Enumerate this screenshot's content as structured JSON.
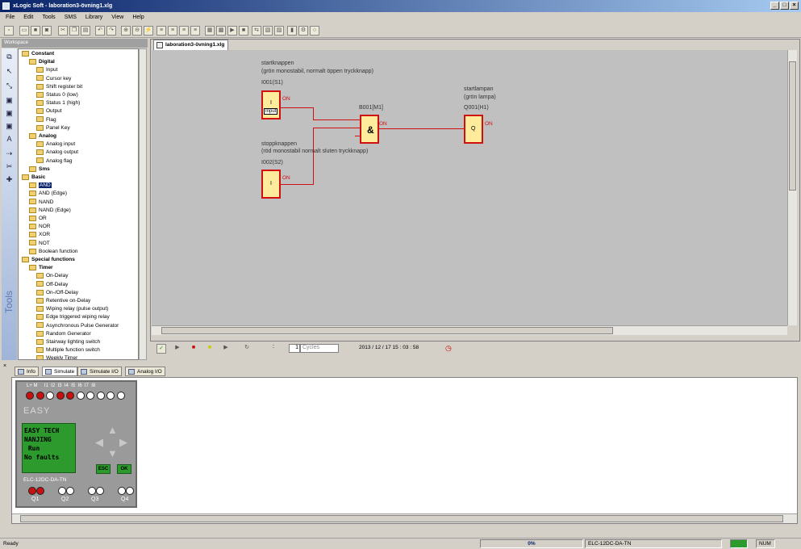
{
  "window": {
    "title": "xLogic Soft - laboration3-övning1.xlg"
  },
  "menu": [
    "File",
    "Edit",
    "Tools",
    "SMS",
    "Library",
    "View",
    "Help"
  ],
  "workspace": {
    "label": "Workspace",
    "vertical_label": "Tools"
  },
  "tree": [
    {
      "label": "Constant",
      "bold": true,
      "level": 0
    },
    {
      "label": "Digital",
      "bold": true,
      "level": 1
    },
    {
      "label": "Input",
      "icon": "I",
      "level": 2
    },
    {
      "label": "Cursor key",
      "icon": "C",
      "level": 2
    },
    {
      "label": "Shift register bit",
      "icon": "S",
      "level": 2
    },
    {
      "label": "Status 0 (low)",
      "icon": "lo",
      "level": 2
    },
    {
      "label": "Status 1 (high)",
      "icon": "hi",
      "level": 2
    },
    {
      "label": "Output",
      "icon": "Q",
      "level": 2
    },
    {
      "label": "Flag",
      "icon": "F",
      "level": 2
    },
    {
      "label": "Panel Key",
      "icon": "P",
      "level": 2
    },
    {
      "label": "Analog",
      "bold": true,
      "level": 1
    },
    {
      "label": "Analog input",
      "icon": "AI",
      "level": 2
    },
    {
      "label": "Analog output",
      "icon": "AQ",
      "level": 2
    },
    {
      "label": "Analog flag",
      "icon": "AF",
      "level": 2
    },
    {
      "label": "Sms",
      "bold": true,
      "level": 1
    },
    {
      "label": "Basic",
      "bold": true,
      "level": 0
    },
    {
      "label": "AND",
      "icon": "&",
      "level": 1,
      "selected": true
    },
    {
      "label": "AND (Edge)",
      "icon": "&",
      "level": 1
    },
    {
      "label": "NAND",
      "icon": "&",
      "level": 1
    },
    {
      "label": "NAND (Edge)",
      "icon": "&",
      "level": 1
    },
    {
      "label": "OR",
      "icon": "≥1",
      "level": 1
    },
    {
      "label": "NOR",
      "icon": "≥1",
      "level": 1
    },
    {
      "label": "XOR",
      "icon": "=1",
      "level": 1
    },
    {
      "label": "NOT",
      "icon": "1",
      "level": 1
    },
    {
      "label": "Boolean function",
      "icon": "B",
      "level": 1
    },
    {
      "label": "Special functions",
      "bold": true,
      "level": 0
    },
    {
      "label": "Timer",
      "bold": true,
      "level": 1
    },
    {
      "label": "On-Delay",
      "level": 2
    },
    {
      "label": "Off-Delay",
      "level": 2
    },
    {
      "label": "On-/Off-Delay",
      "level": 2
    },
    {
      "label": "Retentive on-Delay",
      "level": 2
    },
    {
      "label": "Wiping relay (pulse output)",
      "level": 2
    },
    {
      "label": "Edge triggered wiping relay",
      "level": 2
    },
    {
      "label": "Asynchronous Pulse Generator",
      "level": 2
    },
    {
      "label": "Random Generator",
      "level": 2
    },
    {
      "label": "Stairway lighting switch",
      "level": 2
    },
    {
      "label": "Multiple function switch",
      "level": 2
    },
    {
      "label": "Weekly Timer",
      "level": 2
    }
  ],
  "document": {
    "tab": "laboration3-övning1.xlg"
  },
  "diagram": {
    "s1_title": "startknappen",
    "s1_desc": "(grön monostabil, normalt öppen tryckknapp)",
    "s1_id": "I001(S1)",
    "s1_sym": "I",
    "s1_state": "ON",
    "s1_tooltip": "Input",
    "s2_title": "stoppknappen",
    "s2_desc": "(röd monostabil normalt sluten tryckknapp)",
    "s2_id": "I002(S2)",
    "s2_sym": "I",
    "s2_state": "ON",
    "and_id": "B001[M1]",
    "and_sym": "&",
    "and_state": "ON",
    "q_title": "startlampan",
    "q_desc": "(grön lampa)",
    "q_id": "Q001(H1)",
    "q_sym": "Q",
    "q_state": "ON"
  },
  "sim": {
    "cycles": "1",
    "cycles_unit": "Cycles",
    "datetime": "2013 / 12 / 17 15 : 03 : 58",
    "colon": ":"
  },
  "panel_tabs": [
    "Info",
    "Simulate",
    "Simulate I/O",
    "Analog I/O"
  ],
  "plc": {
    "top_labels": "L+ M     I1  I2  I3  I4  I5  I6  I7  I8",
    "brand": "EASY",
    "lcd": [
      "EASY TECH",
      "NANJING",
      " Run",
      "No faults"
    ],
    "esc": "ESC",
    "ok": "OK",
    "model": "ELC-12DC-DA-TN",
    "outputs": [
      "Q1",
      "Q2",
      "Q3",
      "Q4"
    ],
    "input_states": [
      true,
      true,
      false,
      true,
      true,
      false,
      false,
      false,
      false,
      false
    ],
    "output_states": [
      true,
      false,
      false,
      false
    ]
  },
  "status": {
    "left": "Ready",
    "progress": "0%",
    "model": "ELC-12DC-DA-TN",
    "num": "NUM"
  },
  "colors": {
    "wire": "#d01010",
    "block": "#ffeb9c",
    "lcd": "#2c9a2c"
  }
}
